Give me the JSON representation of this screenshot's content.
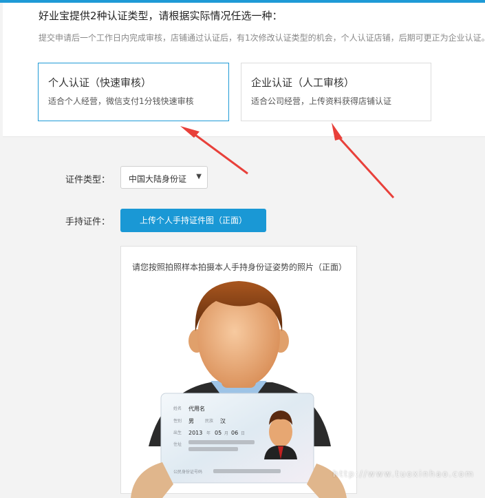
{
  "header": {
    "title": "好业宝提供2种认证类型，请根据实际情况任选一种：",
    "note": "提交申请后一个工作日内完成审核，店铺通过认证后，有1次修改认证类型的机会，个人认证店铺，后期可更正为企业认证。"
  },
  "options": [
    {
      "title": "个人认证（快速审核）",
      "desc": "适合个人经营，微信支付1分钱快速审核",
      "selected": true
    },
    {
      "title": "企业认证（人工审核）",
      "desc": "适合公司经营，上传资料获得店铺认证",
      "selected": false
    }
  ],
  "form": {
    "id_type_label": "证件类型：",
    "id_type_value": "中国大陆身份证",
    "handheld_label": "手持证件：",
    "upload_label": "上传个人手持证件图（正面）"
  },
  "sample": {
    "instruction": "请您按照拍照样本拍摄本人手持身份证姿势的照片（正面）",
    "card": {
      "name_label": "姓名",
      "name": "代用名",
      "sex_label": "性别",
      "sex": "男",
      "nation_label": "民族",
      "nation": "汉",
      "birth_label": "出生",
      "birth_year": "2013",
      "birth_month": "05",
      "birth_day": "06",
      "birth_unit_year": "年",
      "birth_unit_month": "月",
      "birth_unit_day": "日",
      "address_label": "住址",
      "id_label": "公民身份证号码"
    }
  },
  "watermark": "http://www.tuoxinhao.com",
  "colors": {
    "accent": "#1e9ad6",
    "arrow": "#e8403a"
  }
}
